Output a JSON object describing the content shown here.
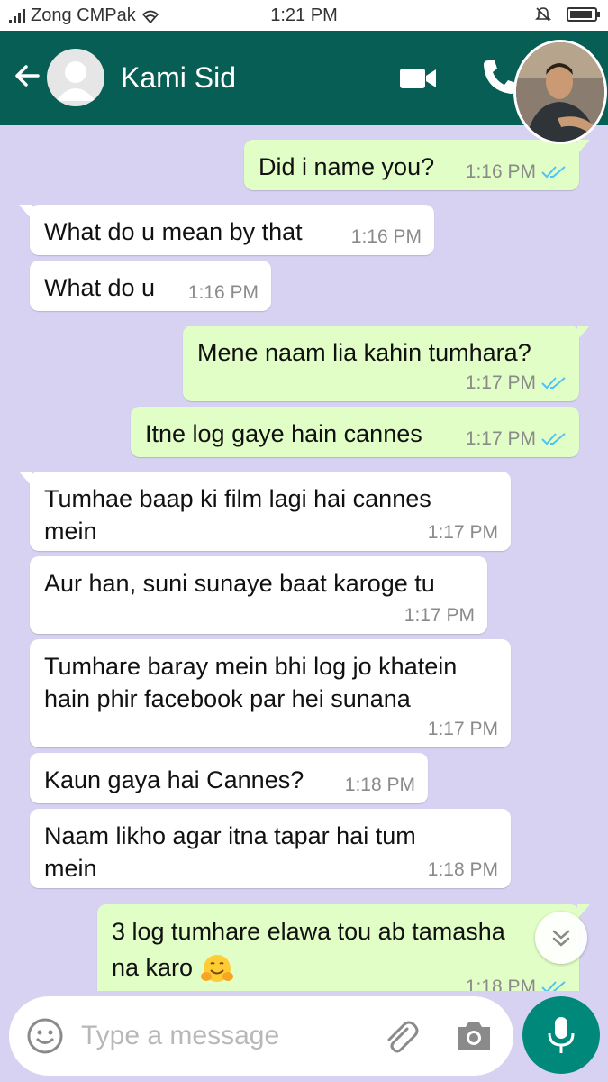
{
  "status_bar": {
    "carrier": "Zong CMPak",
    "time": "1:21 PM"
  },
  "header": {
    "contact_name": "Kami Sid",
    "back_icon": "arrow-left-icon",
    "video_icon": "video-call-icon",
    "call_icon": "phone-icon"
  },
  "colors": {
    "header": "#075e54",
    "chat_background": "#d8d2f2",
    "outgoing_bubble": "#e1fec6",
    "incoming_bubble": "#ffffff",
    "read_ticks": "#4fc3f7",
    "mic_button": "#00897b"
  },
  "messages": [
    {
      "direction": "out",
      "lines": [
        "Did i name you?"
      ],
      "time": "1:16 PM",
      "read": true
    },
    {
      "direction": "in",
      "lines": [
        "What do u mean by that"
      ],
      "time": "1:16 PM"
    },
    {
      "direction": "in",
      "lines": [
        "What do u"
      ],
      "time": "1:16 PM"
    },
    {
      "direction": "out",
      "lines": [
        "Mene naam lia kahin tumhara?"
      ],
      "time": "1:17 PM",
      "read": true
    },
    {
      "direction": "out",
      "lines": [
        "Itne log gaye hain cannes"
      ],
      "time": "1:17 PM",
      "read": true
    },
    {
      "direction": "in",
      "lines": [
        "Tumhae baap ki film lagi hai cannes",
        "mein"
      ],
      "time": "1:17 PM"
    },
    {
      "direction": "in",
      "lines": [
        "Aur han,  suni sunaye baat karoge tu"
      ],
      "time": "1:17 PM"
    },
    {
      "direction": "in",
      "lines": [
        "Tumhare baray mein bhi log jo khatein",
        "hain phir facebook par hei sunana"
      ],
      "time": "1:17 PM"
    },
    {
      "direction": "in",
      "lines": [
        "Kaun gaya hai Cannes?"
      ],
      "time": "1:18 PM"
    },
    {
      "direction": "in",
      "lines": [
        "Naam likho agar itna tapar hai tum",
        "mein"
      ],
      "time": "1:18 PM"
    },
    {
      "direction": "out",
      "lines": [
        "3 log tumhare elawa tou ab tamasha",
        "na karo"
      ],
      "time": "1:18 PM",
      "read": true,
      "emoji": "hugging-face-emoji"
    }
  ],
  "input": {
    "placeholder": "Type a message",
    "value": ""
  }
}
